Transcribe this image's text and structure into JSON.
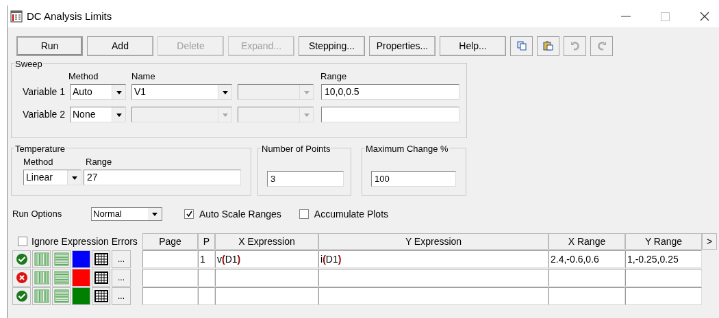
{
  "window": {
    "title": "DC Analysis Limits"
  },
  "buttons": [
    {
      "label": "Run",
      "disabled": false,
      "default": true
    },
    {
      "label": "Add",
      "disabled": false,
      "default": false
    },
    {
      "label": "Delete",
      "disabled": true,
      "default": false
    },
    {
      "label": "Expand...",
      "disabled": true,
      "default": false
    },
    {
      "label": "Stepping...",
      "disabled": false,
      "default": false
    },
    {
      "label": "Properties...",
      "disabled": false,
      "default": false
    },
    {
      "label": "Help...",
      "disabled": false,
      "default": false
    }
  ],
  "tool_buttons": [
    {
      "kind": "copy",
      "disabled": false
    },
    {
      "kind": "paste",
      "disabled": false
    },
    {
      "kind": "undo",
      "disabled": true
    },
    {
      "kind": "redo",
      "disabled": true
    }
  ],
  "sweep": {
    "title": "Sweep",
    "method_header": "Method",
    "name_header": "Name",
    "range_header": "Range",
    "variables": [
      {
        "label": "Variable 1",
        "method": "Auto",
        "name": "V1",
        "name_enabled": true,
        "range": "10,0,0.5"
      },
      {
        "label": "Variable 2",
        "method": "None",
        "name_enabled": false
      }
    ]
  },
  "temperature": {
    "title": "Temperature",
    "method_header": "Method",
    "range_header": "Range",
    "method": "Linear",
    "range": "27"
  },
  "number_of_points": {
    "title": "Number of Points",
    "value": "3"
  },
  "maximum_change": {
    "title": "Maximum Change %",
    "value": "100"
  },
  "run_options": {
    "label": "Run Options",
    "value": "Normal"
  },
  "options": [
    {
      "label": "Auto Scale Ranges",
      "checked": true
    },
    {
      "label": "Accumulate Plots",
      "checked": false
    }
  ],
  "ignore_errors": {
    "label": "Ignore Expression Errors",
    "checked": false
  },
  "table": {
    "columns": [
      "Page",
      "P",
      "X Expression",
      "Y Expression",
      "X Range",
      "Y Range"
    ],
    "more": ">",
    "rows": [
      {
        "enabled": true,
        "color": "#0000ff",
        "menu": "...",
        "p": "1",
        "x_expression": "v**(**D1**)**",
        "y_expression": "i**(**D1**)**",
        "x_range": "2.4,-0.6,0.6",
        "y_range": "1,-0.25,0.25"
      },
      {
        "enabled": false,
        "color": "#ff0000",
        "menu": "..."
      },
      {
        "enabled": true,
        "color": "#008000",
        "menu": "..."
      }
    ]
  }
}
